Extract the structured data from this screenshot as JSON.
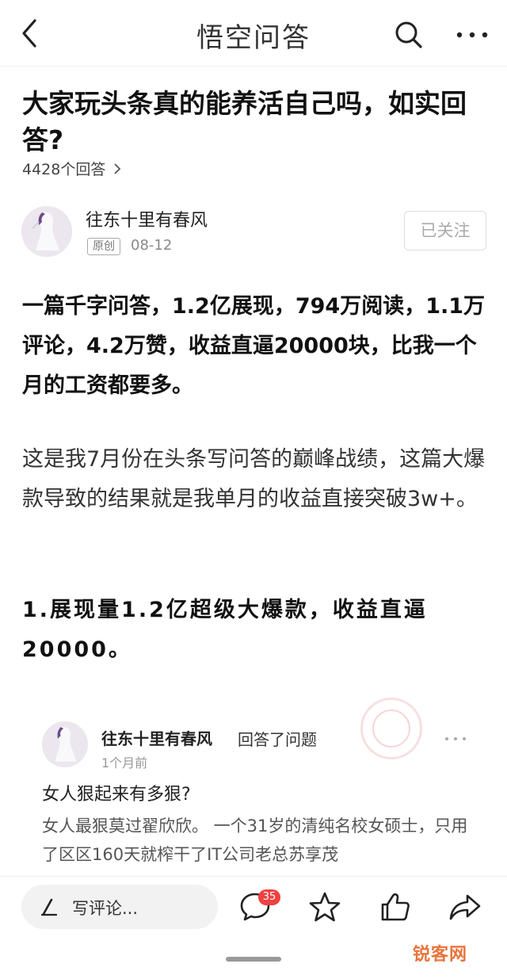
{
  "header": {
    "app_title": "悟空问答"
  },
  "question": {
    "title": "大家玩头条真的能养活自己吗，如实回答?",
    "answers_count": "4428个回答"
  },
  "answer": {
    "author": "往东十里有春风",
    "original_tag": "原创",
    "date": "08-12",
    "follow_label": "已关注",
    "paragraphs": [
      "一篇千字问答，1.2亿展现，794万阅读，1.1万评论，4.2万赞，收益直逼20000块，比我一个月的工资都要多。",
      "这是我7月份在头条写问答的巅峰战绩，这篇大爆款导致的结果就是我单月的收益直接突破3w+。",
      "1.展现量1.2亿超级大爆款，收益直逼20000。"
    ]
  },
  "embedded_card": {
    "author": "往东十里有春风",
    "action": "回答了问题",
    "time": "1个月前",
    "question": "女人狠起来有多狠?",
    "excerpt": "女人最狠莫过翟欣欣。 一个31岁的清纯名校女硕士，只用了区区160天就榨干了IT公司老总苏享茂"
  },
  "bottom_bar": {
    "comment_placeholder": "写评论...",
    "comment_count": "35"
  },
  "watermark": "锐客网",
  "colors": {
    "badge_red": "#f04142",
    "watermark_orange": "#e8743b"
  }
}
